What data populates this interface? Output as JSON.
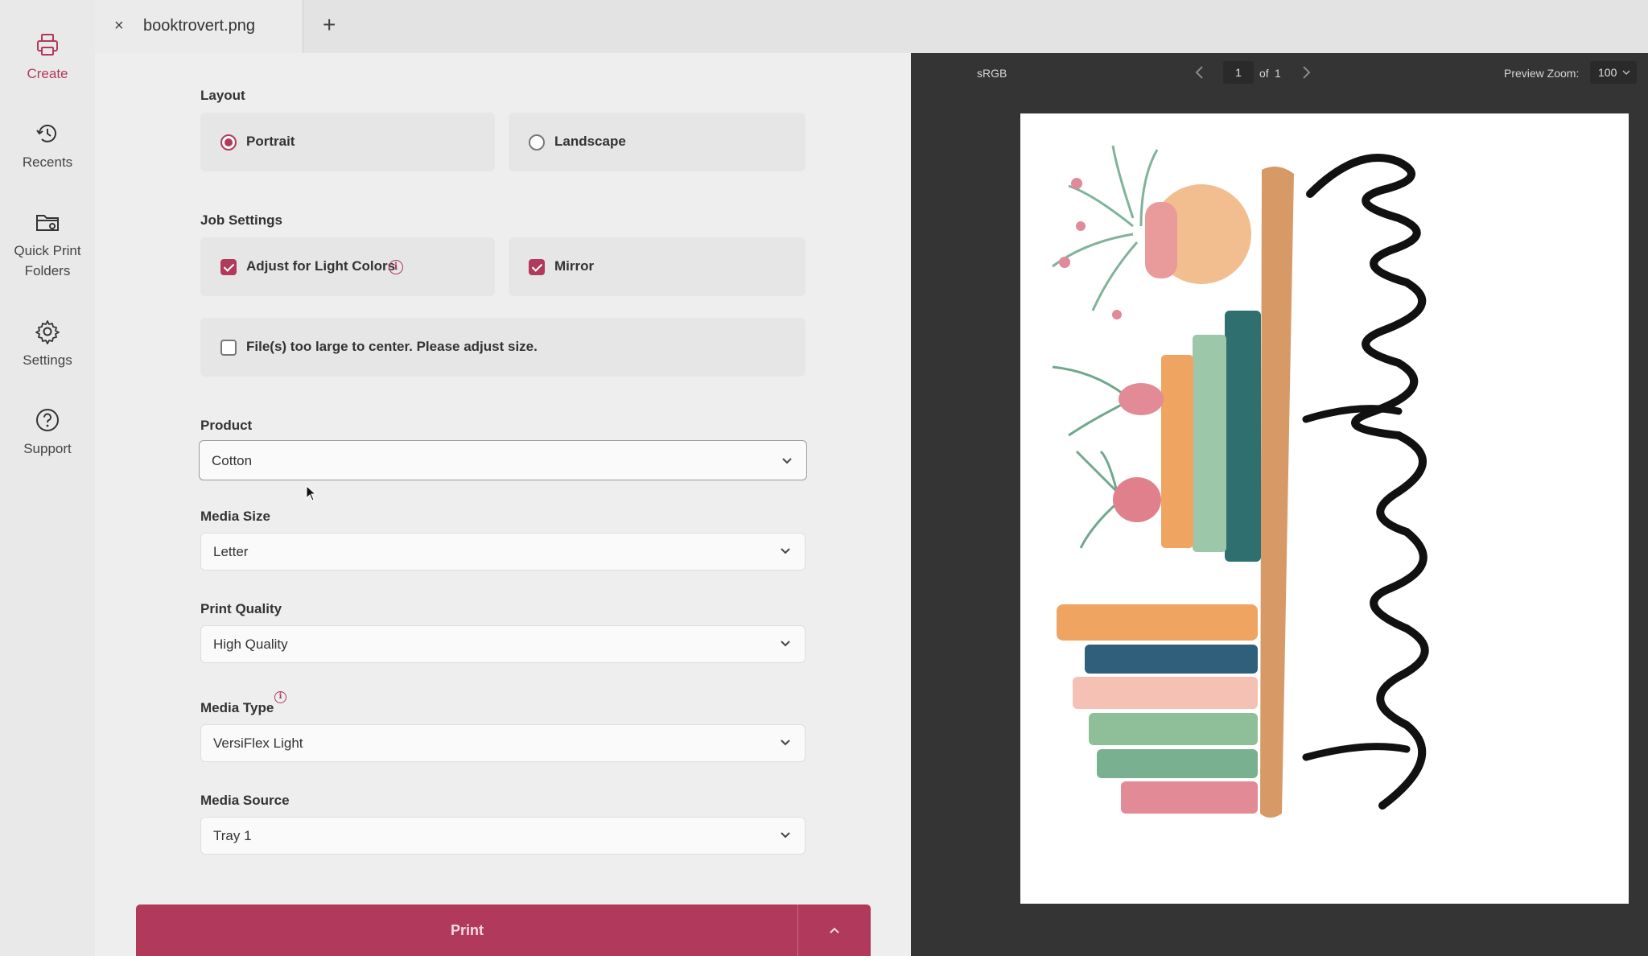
{
  "sidebar": {
    "items": [
      {
        "label": "Create",
        "icon": "printer-icon",
        "active": true
      },
      {
        "label": "Recents",
        "icon": "history-icon"
      },
      {
        "label": "Quick Print\nFolders",
        "icon": "folder-settings-icon"
      },
      {
        "label": "Settings",
        "icon": "gear-icon"
      },
      {
        "label": "Support",
        "icon": "help-circle-icon"
      }
    ]
  },
  "tabs": {
    "active_tab": {
      "close": "×",
      "title": "booktrovert.png"
    },
    "add": "+"
  },
  "layout": {
    "label": "Layout",
    "options": [
      {
        "label": "Portrait",
        "selected": true
      },
      {
        "label": "Landscape",
        "selected": false
      }
    ]
  },
  "job_settings": {
    "label": "Job Settings",
    "adjust_light": {
      "label": "Adjust for Light Colors",
      "checked": true,
      "info": "i"
    },
    "mirror": {
      "label": "Mirror",
      "checked": true
    },
    "too_large": {
      "label": "File(s) too large to center. Please adjust size.",
      "checked": false
    }
  },
  "product": {
    "label": "Product",
    "value": "Cotton"
  },
  "media_size": {
    "label": "Media Size",
    "value": "Letter"
  },
  "print_quality": {
    "label": "Print Quality",
    "value": "High Quality"
  },
  "media_type": {
    "label": "Media Type",
    "value": "VersiFlex Light",
    "info": "i"
  },
  "media_source": {
    "label": "Media Source",
    "value": "Tray 1"
  },
  "print_button": {
    "label": "Print"
  },
  "preview": {
    "color_profile": "sRGB",
    "page": "1",
    "page_of": "of",
    "page_total": "1",
    "zoom_label": "Preview Zoom:",
    "zoom_value": "100"
  },
  "colors": {
    "accent": "#b13a5c",
    "preview_bg": "#343434"
  }
}
